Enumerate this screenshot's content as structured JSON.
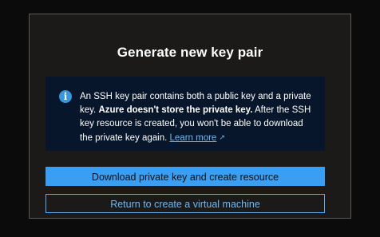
{
  "dialog": {
    "title": "Generate new key pair",
    "info": {
      "icon": "info-icon",
      "text_part1": "An SSH key pair contains both a public key and a private key. ",
      "text_bold": "Azure doesn't store the private key.",
      "text_part2": " After the SSH key resource is created, you won't be able to download the private key again. ",
      "link_label": "Learn more",
      "link_icon": "external-link-icon"
    },
    "primary_button": "Download private key and create resource",
    "secondary_button": "Return to create a virtual machine"
  },
  "colors": {
    "accent": "#3a9ff3",
    "link": "#6cb8f6",
    "info_background": "#07162b",
    "dialog_background": "#1b1a19"
  }
}
